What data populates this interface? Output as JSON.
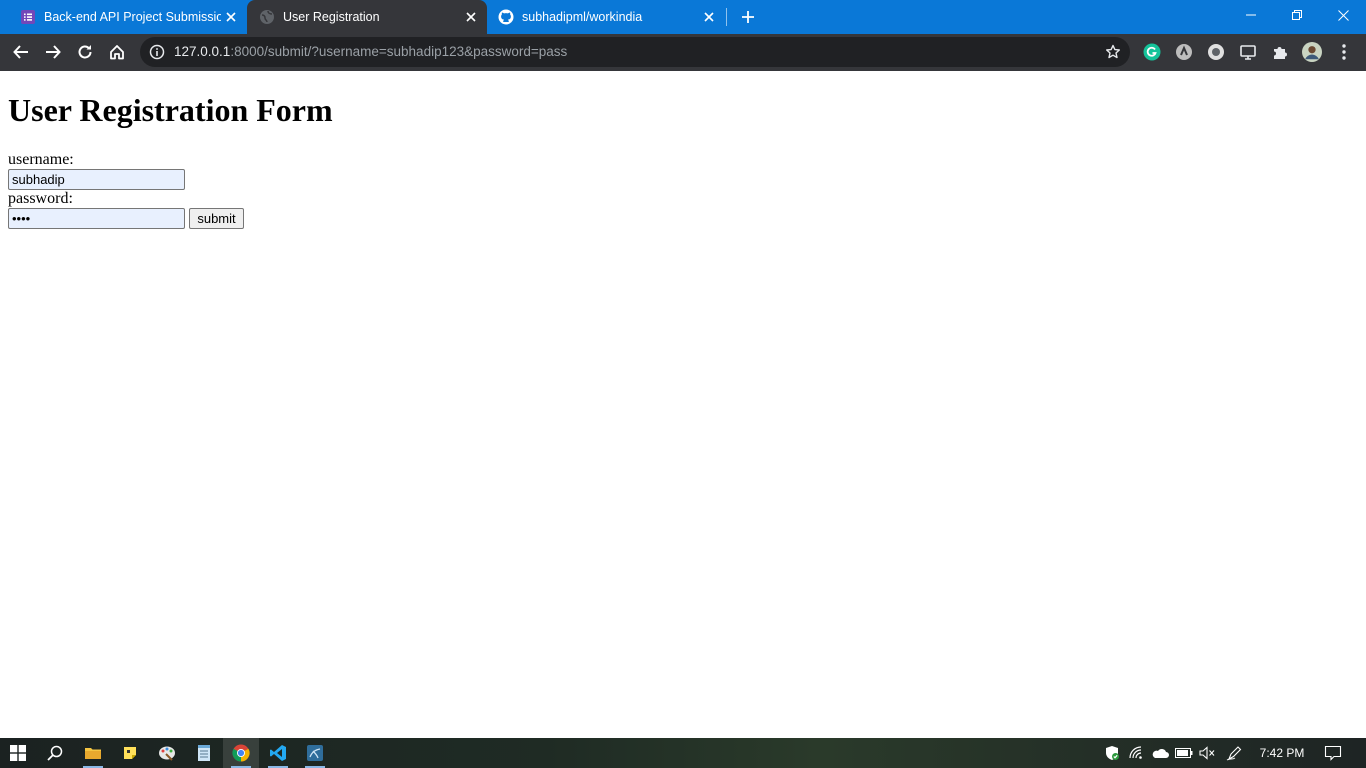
{
  "tabs": [
    {
      "title": "Back-end API Project Submission",
      "icon": "form-list-icon",
      "active": false
    },
    {
      "title": "User Registration",
      "icon": "globe-icon",
      "active": true
    },
    {
      "title": "subhadipml/workindia",
      "icon": "github-icon",
      "active": false
    }
  ],
  "address_bar": {
    "host": "127.0.0.1",
    "rest": ":8000/submit/?username=subhadip123&password=pass"
  },
  "page": {
    "heading": "User Registration Form",
    "username_label": "username:",
    "username_value": "subhadip",
    "password_label": "password:",
    "password_value": "pass",
    "submit_label": "submit"
  },
  "taskbar": {
    "clock": "7:42 PM"
  },
  "colors": {
    "tabstrip": "#0a78d7",
    "toolbar": "#35363a",
    "omnibox": "#202124",
    "autofill": "#e8f0fe"
  }
}
